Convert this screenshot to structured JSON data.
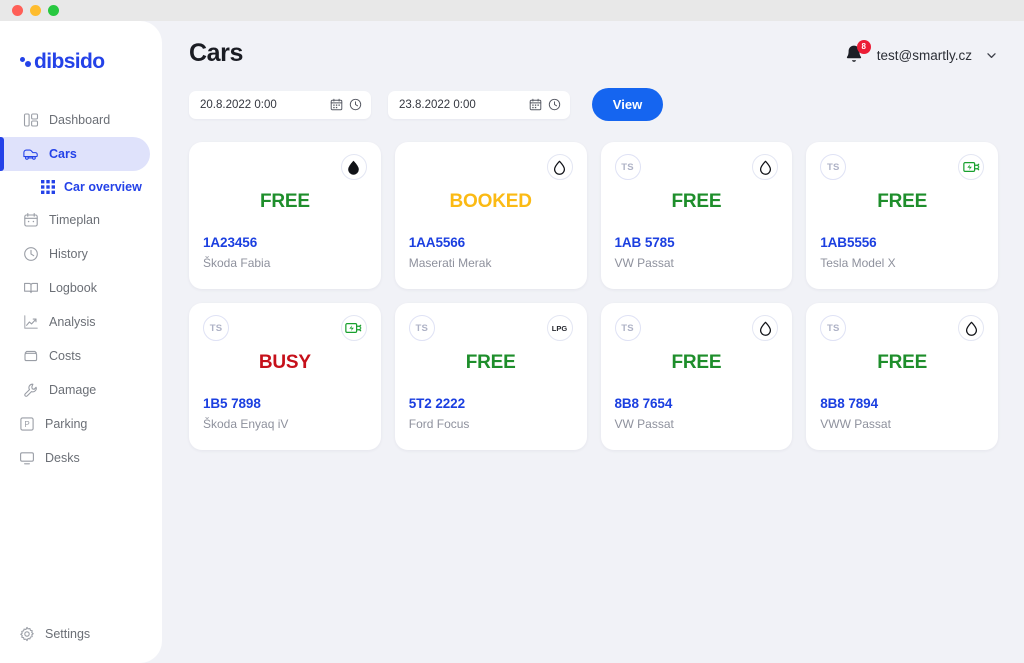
{
  "window": {
    "traffic_lights": [
      "close",
      "minimize",
      "zoom"
    ]
  },
  "sidebar": {
    "logo_text": "dibsido",
    "items": [
      {
        "label": "Dashboard",
        "icon": "dashboard-icon",
        "active": false
      },
      {
        "label": "Cars",
        "icon": "car-icon",
        "active": true
      },
      {
        "label": "Car overview",
        "icon": "grid-icon",
        "sub": true
      },
      {
        "label": "Timeplan",
        "icon": "calendar-icon",
        "active": false
      },
      {
        "label": "History",
        "icon": "clock-icon",
        "active": false
      },
      {
        "label": "Logbook",
        "icon": "book-icon",
        "active": false
      },
      {
        "label": "Analysis",
        "icon": "chart-icon",
        "active": false
      },
      {
        "label": "Costs",
        "icon": "wallet-icon",
        "active": false
      },
      {
        "label": "Damage",
        "icon": "wrench-icon",
        "active": false
      },
      {
        "label": "Parking",
        "icon": "parking-icon",
        "active": false
      },
      {
        "label": "Desks",
        "icon": "monitor-icon",
        "active": false
      }
    ],
    "settings": {
      "label": "Settings",
      "icon": "gear-icon"
    }
  },
  "header": {
    "title": "Cars",
    "notifications": {
      "icon": "bell-icon",
      "count": "8"
    },
    "user_email": "test@smartly.cz",
    "chevron": "chevron-down-icon"
  },
  "filters": {
    "date_from": {
      "value": "20.8.2022 0:00",
      "placeholder": "Date from",
      "calendar_icon": "calendar-icon",
      "clock_icon": "clock-icon"
    },
    "date_to": {
      "value": "23.8.2022 0:00",
      "placeholder": "Date to",
      "calendar_icon": "calendar-icon",
      "clock_icon": "clock-icon"
    },
    "view_label": "View"
  },
  "colors": {
    "brand_blue": "#2442e8",
    "button_blue": "#1565f0",
    "free_green": "#1e8e2b",
    "booked_yellow": "#fbba14",
    "busy_red": "#c6101a",
    "plate_blue": "#1b3fe0",
    "badge_red": "#ec1d36",
    "page_bg": "#f1f2f7",
    "active_pill": "#dfe2fb"
  },
  "cards": [
    {
      "avatar": "",
      "fuel": "drop-filled-icon",
      "fuel_label": "",
      "status": "FREE",
      "status_kind": "free",
      "plate": "1A23456",
      "model": "Škoda Fabia"
    },
    {
      "avatar": "",
      "fuel": "drop-icon",
      "fuel_label": "",
      "status": "BOOKED",
      "status_kind": "booked",
      "plate": "1AA5566",
      "model": "Maserati Merak"
    },
    {
      "avatar": "TS",
      "fuel": "drop-icon",
      "fuel_label": "",
      "status": "FREE",
      "status_kind": "free",
      "plate": "1AB 5785",
      "model": "VW Passat"
    },
    {
      "avatar": "TS",
      "fuel": "electric-icon",
      "fuel_label": "",
      "status": "FREE",
      "status_kind": "free",
      "plate": "1AB5556",
      "model": "Tesla Model X"
    },
    {
      "avatar": "TS",
      "fuel": "electric-icon",
      "fuel_label": "",
      "status": "BUSY",
      "status_kind": "busy",
      "plate": "1B5 7898",
      "model": "Škoda Enyaq iV"
    },
    {
      "avatar": "TS",
      "fuel": "lpg-text",
      "fuel_label": "LPG",
      "status": "FREE",
      "status_kind": "free",
      "plate": "5T2 2222",
      "model": "Ford Focus"
    },
    {
      "avatar": "TS",
      "fuel": "drop-icon",
      "fuel_label": "",
      "status": "FREE",
      "status_kind": "free",
      "plate": "8B8 7654",
      "model": "VW Passat"
    },
    {
      "avatar": "TS",
      "fuel": "drop-icon",
      "fuel_label": "",
      "status": "FREE",
      "status_kind": "free",
      "plate": "8B8 7894",
      "model": "VWW Passat"
    }
  ]
}
